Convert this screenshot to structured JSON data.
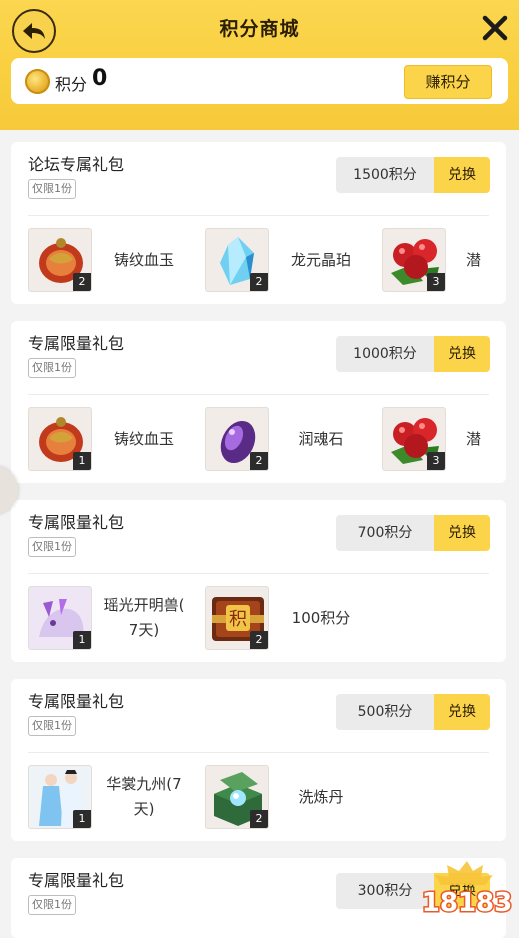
{
  "header": {
    "title": "积分商城",
    "back_icon": "back-arrow-icon",
    "close_icon": "close-icon"
  },
  "points": {
    "label": "积分",
    "value": "0",
    "earn_label": "赚积分",
    "coin_icon": "coin-icon"
  },
  "packages": [
    {
      "name": "论坛专属礼包",
      "limit": "仅限1份",
      "price": "1500积分",
      "exchange_label": "兑换",
      "items": [
        {
          "name": "铸纹血玉",
          "count": "2",
          "icon": "jade-icon"
        },
        {
          "name": "龙元晶珀",
          "count": "2",
          "icon": "crystal-icon"
        },
        {
          "name": "潜",
          "count": "3",
          "icon": "berries-icon"
        }
      ]
    },
    {
      "name": "专属限量礼包",
      "limit": "仅限1份",
      "price": "1000积分",
      "exchange_label": "兑换",
      "items": [
        {
          "name": "铸纹血玉",
          "count": "1",
          "icon": "jade-icon"
        },
        {
          "name": "润魂石",
          "count": "2",
          "icon": "soul-stone-icon"
        },
        {
          "name": "潜",
          "count": "3",
          "icon": "berries-icon"
        }
      ]
    },
    {
      "name": "专属限量礼包",
      "limit": "仅限1份",
      "price": "700积分",
      "exchange_label": "兑换",
      "items": [
        {
          "name": "瑶光开明兽(7天)",
          "name_line1": "瑶光开明兽(",
          "name_line2": "7天)",
          "count": "1",
          "icon": "beast-mount-icon"
        },
        {
          "name": "100积分",
          "count": "2",
          "icon": "points-chest-icon",
          "chest_char": "积"
        }
      ]
    },
    {
      "name": "专属限量礼包",
      "limit": "仅限1份",
      "price": "500积分",
      "exchange_label": "兑换",
      "items": [
        {
          "name": "华裳九州(7天)",
          "name_line1": "华裳九州(7",
          "name_line2": "天)",
          "count": "1",
          "icon": "costume-icon"
        },
        {
          "name": "洗炼丹",
          "count": "2",
          "icon": "elixir-box-icon"
        }
      ]
    },
    {
      "name": "专属限量礼包",
      "limit": "仅限1份",
      "price": "300积分",
      "exchange_label": "兑换",
      "items": []
    }
  ],
  "watermark": {
    "text": "18183",
    "icon": "watermark-logo-icon"
  },
  "side_avatar": {
    "icon": "avatar-icon"
  },
  "colors": {
    "accent_yellow": "#fbd44a",
    "header_yellow": "#f9cf3f",
    "count_badge": "#2c2c2c"
  }
}
